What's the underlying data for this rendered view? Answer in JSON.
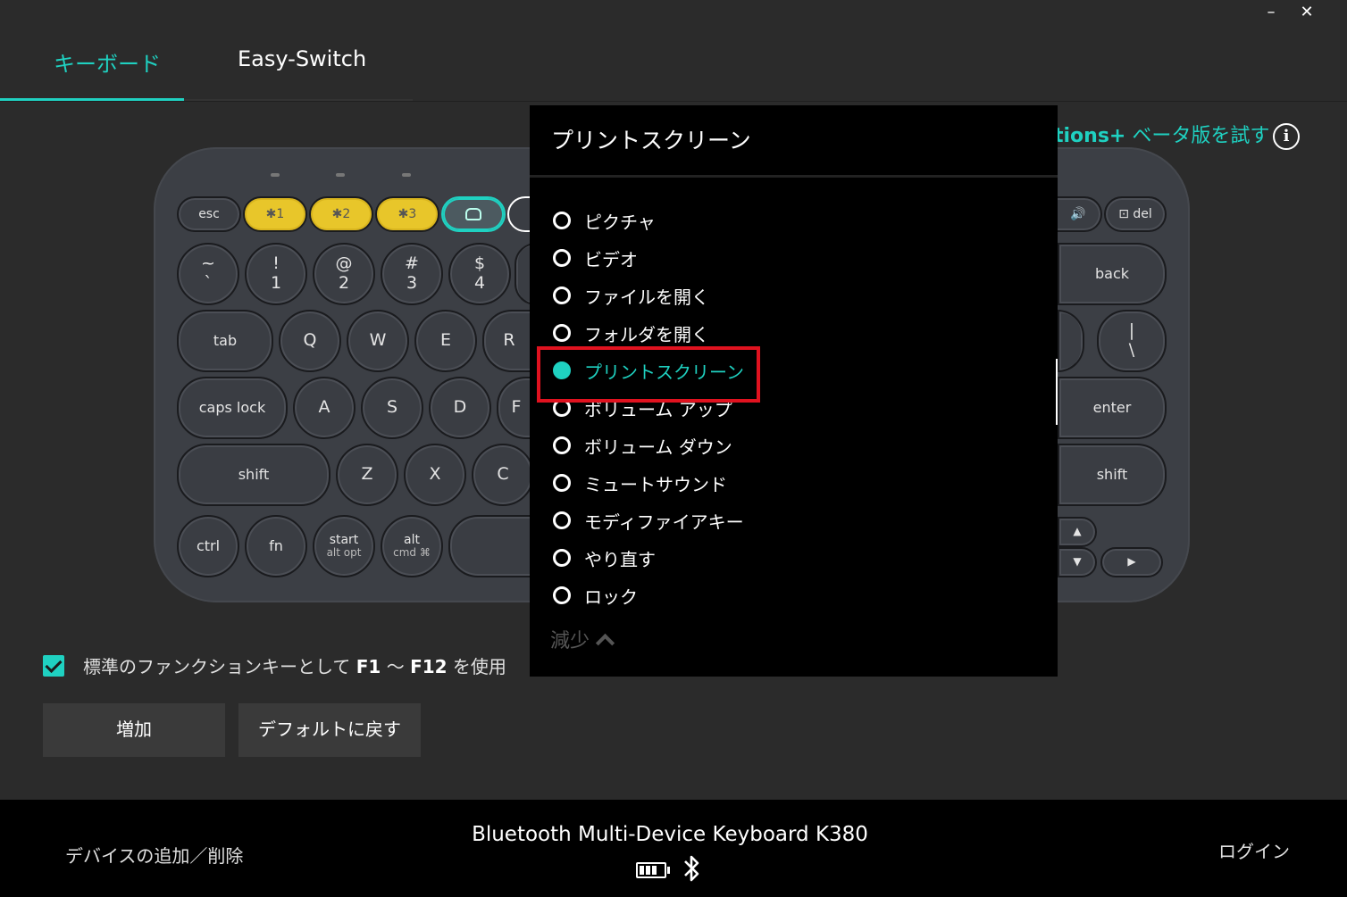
{
  "window": {
    "minimize": "–",
    "close": "✕"
  },
  "tabs": [
    {
      "label": "キーボード"
    },
    {
      "label": "Easy-Switch"
    }
  ],
  "beta": {
    "brand": "tions+",
    "text": " ベータ版を試す"
  },
  "info_icon": "i",
  "keyboard": {
    "fn_row": {
      "esc": "esc",
      "f1": "✱1",
      "f2": "✱2",
      "f3": "✱3",
      "del": "⊡ del"
    },
    "num_row": [
      [
        "~",
        "`"
      ],
      [
        "!",
        "1"
      ],
      [
        "@",
        "2"
      ],
      [
        "#",
        "3"
      ],
      [
        "$",
        "4"
      ]
    ],
    "back": "back",
    "top_row": {
      "tab": "tab",
      "q": "Q",
      "w": "W",
      "e": "E",
      "r": "R",
      "backslash_top": "|",
      "backslash_bottom": "\\"
    },
    "home_row": {
      "caps": "caps lock",
      "a": "A",
      "s": "S",
      "d": "D",
      "f": "F",
      "enter": "enter"
    },
    "bottom_row": {
      "shift": "shift",
      "z": "Z",
      "x": "X",
      "c": "C",
      "shift_r": "shift"
    },
    "mod_row": {
      "ctrl": "ctrl",
      "fn": "fn",
      "start": "start",
      "start_sub": "alt opt",
      "alt": "alt",
      "alt_sub": "cmd ⌘",
      "up": "▲",
      "down": "▼",
      "right": "▶"
    }
  },
  "checkbox": {
    "pre": "標準のファンクションキーとして ",
    "f1": "F1",
    "mid": " 〜 ",
    "f12": "F12",
    "post": " を使用",
    "checked": true
  },
  "buttons": {
    "add": "増加",
    "reset": "デフォルトに戻す"
  },
  "popup": {
    "title": "プリントスクリーン",
    "items": [
      "ピクチャ",
      "ビデオ",
      "ファイルを開く",
      "フォルダを開く",
      "プリントスクリーン",
      "ボリューム アップ",
      "ボリューム ダウン",
      "ミュートサウンド",
      "モディファイアキー",
      "やり直す",
      "ロック"
    ],
    "selected": "プリントスクリーン",
    "collapse": "減少"
  },
  "footer": {
    "add_device": "デバイスの追加／削除",
    "device": "Bluetooth Multi-Device Keyboard K380",
    "login": "ログイン"
  },
  "colors": {
    "accent": "#1fd1c1",
    "highlight": "#e0121f",
    "yellow_key": "#e8c62a"
  }
}
